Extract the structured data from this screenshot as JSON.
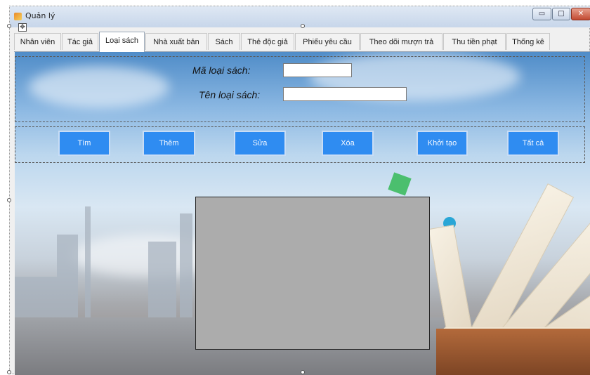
{
  "window": {
    "title": "Quản lý",
    "icon": "app-icon"
  },
  "tabs": [
    {
      "label": "Nhân viên",
      "active": false
    },
    {
      "label": "Tác giả",
      "active": false
    },
    {
      "label": "Loại sách",
      "active": true
    },
    {
      "label": "Nhà xuất bản",
      "active": false
    },
    {
      "label": "Sách",
      "active": false
    },
    {
      "label": "Thẻ độc giả",
      "active": false
    },
    {
      "label": "Phiếu yêu cầu",
      "active": false
    },
    {
      "label": "Theo dõi mượn trả",
      "active": false
    },
    {
      "label": "Thu tiền phạt",
      "active": false
    },
    {
      "label": "Thống kê",
      "active": false
    }
  ],
  "form": {
    "ma_loai_label": "Mã loại sách:",
    "ma_loai_value": "",
    "ten_loai_label": "Tên loại sách:",
    "ten_loai_value": ""
  },
  "buttons": {
    "tim": "Tìm",
    "them": "Thêm",
    "sua": "Sửa",
    "xoa": "Xóa",
    "khoi_tao": "Khởi tạo",
    "tat_ca": "Tất cả"
  },
  "colors": {
    "button_bg": "#2f8cf1",
    "grid_bg": "#acacac"
  }
}
